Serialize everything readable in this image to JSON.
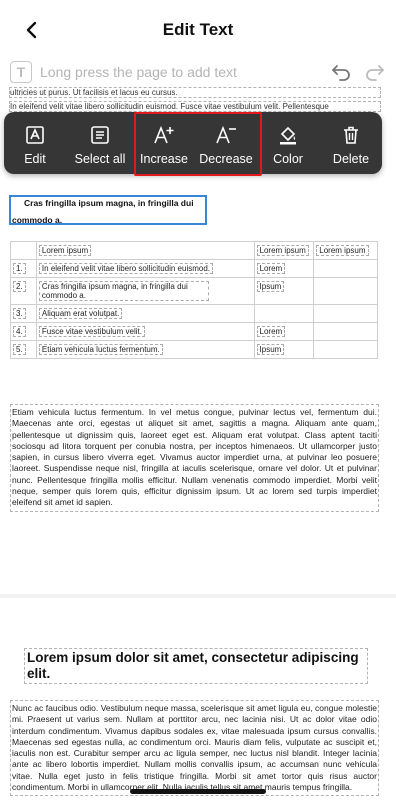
{
  "header": {
    "title": "Edit Text"
  },
  "hint": {
    "text": "Long press the page to add text"
  },
  "page_top": {
    "line1": "ultricies ut purus. Ut facilisis et lacus eu cursus.",
    "line2": "In eleifend velit vitae libero sollicitudin euismod. Fusce vitae vestibulum velit. Pellentesque"
  },
  "toolbar": {
    "items": [
      {
        "label": "Edit",
        "icon": "edit-text-icon"
      },
      {
        "label": "Select all",
        "icon": "select-all-icon"
      },
      {
        "label": "Increase",
        "icon": "increase-font-icon"
      },
      {
        "label": "Decrease",
        "icon": "decrease-font-icon"
      },
      {
        "label": "Color",
        "icon": "color-fill-icon"
      },
      {
        "label": "Delete",
        "icon": "trash-icon"
      }
    ],
    "highlight_color": "#e01a1a",
    "background": "#363636"
  },
  "selected_text": {
    "line1": "Cras fringilla ipsum magna, in fringilla dui",
    "line2": "commodo  a."
  },
  "table": {
    "header": [
      "",
      "Lorem ipsum",
      "Lorem ipsum",
      "Lorem ipsum"
    ],
    "rows": [
      [
        "1.",
        "In eleifend velit vitae libero sollicitudin euismod.",
        "Lorem",
        ""
      ],
      [
        "2.",
        "Cras fringilla ipsum magna, in fringilla dui  commodo  a.",
        "Ipsum",
        ""
      ],
      [
        "3.",
        "Aliquam erat volutpat.",
        "",
        ""
      ],
      [
        "4.",
        "Fusce vitae vestibulum velit.",
        "Lorem",
        ""
      ],
      [
        "5.",
        "Etiam vehicula luctus fermentum.",
        "Ipsum",
        ""
      ]
    ]
  },
  "paragraph1": "Etiam vehicula luctus fermentum. In vel metus congue, pulvinar lectus vel, fermentum dui. Maecenas ante orci, egestas ut aliquet sit amet, sagittis a magna. Aliquam ante quam, pellentesque ut dignissim quis, laoreet eget est. Aliquam erat volutpat. Class aptent taciti sociosqu ad litora torquent per conubia nostra, per inceptos himenaeos. Ut ullamcorper justo sapien, in cursus libero viverra eget. Vivamus auctor imperdiet urna, at pulvinar leo posuere laoreet. Suspendisse neque nisl, fringilla at iaculis scelerisque, ornare vel dolor. Ut et pulvinar nunc. Pellentesque fringilla mollis efficitur. Nullam venenatis commodo imperdiet. Morbi velit neque, semper quis lorem quis, efficitur dignissim ipsum. Ut ac lorem sed turpis imperdiet eleifend sit amet id sapien.",
  "heading": "Lorem ipsum dolor sit amet, consectetur adipiscing elit.",
  "paragraph2": "Nunc ac faucibus odio. Vestibulum neque massa, scelerisque sit amet ligula eu, congue molestie mi. Praesent ut varius sem. Nullam at porttitor arcu, nec lacinia nisi. Ut ac dolor vitae odio interdum condimentum. Vivamus dapibus sodales ex, vitae malesuada ipsum cursus convallis. Maecenas sed egestas nulla, ac condimentum orci. Mauris diam felis, vulputate ac suscipit et, iaculis non est. Curabitur semper arcu ac ligula semper, nec luctus nisl blandit. Integer lacinia ante ac libero lobortis imperdiet. Nullam mollis convallis ipsum, ac accumsan nunc vehicula vitae. Nulla eget justo in felis tristique fringilla. Morbi sit amet tortor quis risus auctor condimentum. Morbi in ullamcorper elit. Nulla iaculis tellus sit amet mauris tempus fringilla."
}
